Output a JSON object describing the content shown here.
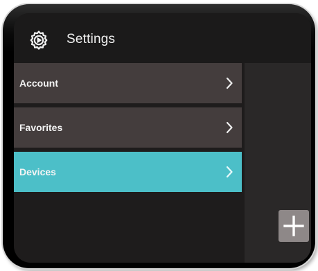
{
  "header": {
    "title": "Settings",
    "icon": "gear-icon"
  },
  "menu": {
    "items": [
      {
        "label": "Account",
        "icon": "chevron-right-icon",
        "selected": false
      },
      {
        "label": "Favorites",
        "icon": "chevron-right-icon",
        "selected": false
      },
      {
        "label": "Devices",
        "icon": "chevron-right-icon",
        "selected": true
      }
    ]
  },
  "add_button": {
    "icon": "plus-icon"
  },
  "colors": {
    "accent": "#4cbfc8",
    "item_background": "#443d3d",
    "screen_background": "#1e1c1c",
    "add_button_background": "#8e8888"
  }
}
